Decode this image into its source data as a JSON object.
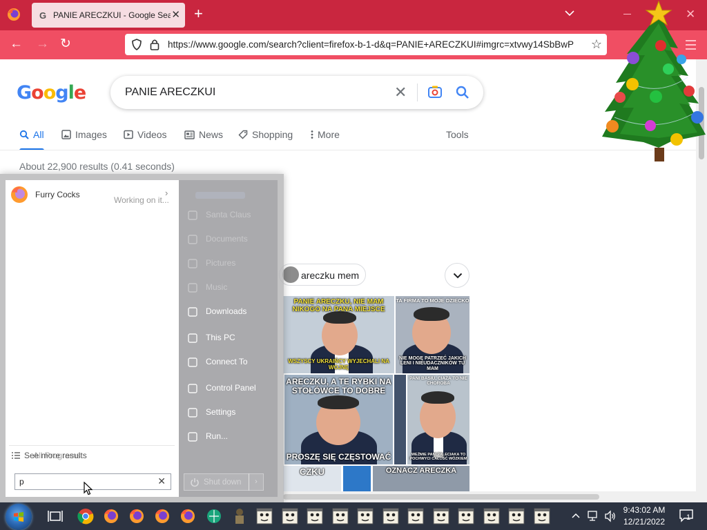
{
  "browser": {
    "tab_title": "PANIE ARECZKUI - Google Search",
    "tab_favicon": "G",
    "url": "https://www.google.com/search?client=firefox-b-1-d&q=PANIE+ARECZKUI#imgrc=xtvwy14SbBwP",
    "theme_colors": {
      "tabbar": "#c9263f",
      "navbar": "#f04e63"
    }
  },
  "google": {
    "logo_letters": [
      {
        "ch": "G",
        "color": "#4285f4"
      },
      {
        "ch": "o",
        "color": "#ea4335"
      },
      {
        "ch": "o",
        "color": "#fbbc05"
      },
      {
        "ch": "g",
        "color": "#4285f4"
      },
      {
        "ch": "l",
        "color": "#34a853"
      },
      {
        "ch": "e",
        "color": "#ea4335"
      }
    ],
    "query": "PANIE ARECZKUI",
    "tabs": [
      {
        "label": "All",
        "icon": "search-icon",
        "active": true
      },
      {
        "label": "Images",
        "icon": "image-icon",
        "active": false
      },
      {
        "label": "Videos",
        "icon": "play-icon",
        "active": false
      },
      {
        "label": "News",
        "icon": "news-icon",
        "active": false
      },
      {
        "label": "Shopping",
        "icon": "tag-icon",
        "active": false
      },
      {
        "label": "More",
        "icon": "more-vert-icon",
        "active": false
      }
    ],
    "tools_label": "Tools",
    "result_stats": "About 22,900 results (0.41 seconds)",
    "chip_label": "areczku mem",
    "memes": [
      {
        "top": "PANIE ARECZKU, NIE MAM NIKOGO NA PANA MIEJSCE",
        "bottom": "WSZYSCY UKRAIŃCY WYJECHALI NA WOJNĘ"
      },
      {
        "top": "TA FIRMA TO MOJE DZIECKO",
        "bottom": "NIE MOGĘ PATRZEĆ JAKICH LENI I NIEUDACZNIKÓW TU MAM"
      },
      {
        "top": "ARECZKU, A TE RYBKI NA STOŁÓWCE TO DOBRE",
        "bottom": "PROSZĘ SIĘ CZĘSTOWAĆ"
      },
      {
        "top": "PANI BASIU, CIĄŻA TO NIE CHOROBA",
        "bottom": "WEŹMIE PANI PALECIAKA TO POCHWYCI CAŁOŚĆ WÓZKIEM"
      },
      {
        "top": "CZKU",
        "bottom": ""
      },
      {
        "top": "OZNACZ ARECZKA",
        "bottom": ""
      }
    ]
  },
  "start_menu": {
    "program": {
      "name": "Furry Cocks",
      "status": "Working on it..."
    },
    "more_results_label": "See more results",
    "more_results_ghost": "All Programs",
    "search_value": "p",
    "right_links": [
      {
        "label": "Santa Claus",
        "icon": "user-folder-icon",
        "dim": true
      },
      {
        "label": "Documents",
        "icon": "documents-icon",
        "dim": true
      },
      {
        "label": "Pictures",
        "icon": "pictures-icon",
        "dim": true
      },
      {
        "label": "Music",
        "icon": "music-icon",
        "dim": true
      },
      {
        "label": "Downloads",
        "icon": "downloads-icon",
        "dim": false
      },
      {
        "label": "This PC",
        "icon": "computer-icon",
        "dim": false
      },
      {
        "label": "Connect To",
        "icon": "connect-icon",
        "dim": false
      },
      {
        "label": "Control Panel",
        "icon": "control-panel-icon",
        "dim": false
      },
      {
        "label": "Settings",
        "icon": "settings-gear-icon",
        "dim": false
      },
      {
        "label": "Run...",
        "icon": "run-icon",
        "dim": false
      }
    ],
    "shutdown_label": "Shut down"
  },
  "taskbar": {
    "time": "9:43:02 AM",
    "date": "12/21/2022",
    "notification_count": "1"
  }
}
